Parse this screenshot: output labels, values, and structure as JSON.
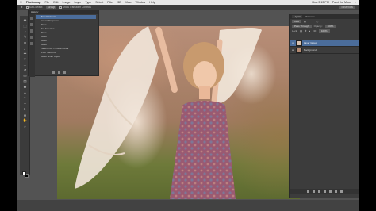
{
  "menubar": {
    "apple": "",
    "app_name": "Photoshop",
    "items": [
      "File",
      "Edit",
      "Image",
      "Layer",
      "Type",
      "Select",
      "Filter",
      "3D",
      "View",
      "Window",
      "Help"
    ],
    "right": [
      "Mon 3:13 PM",
      "Paint the Moon"
    ]
  },
  "options": {
    "auto_select_label": "Auto-Select:",
    "auto_select_value": "Group",
    "show_transform_label": "Show Transform Controls",
    "workspace": "Essentials"
  },
  "history_panel": {
    "title": "History",
    "items": [
      {
        "label": "Select Canvas",
        "selected": true
      },
      {
        "label": "Adjust Sharpness",
        "selected": false
      },
      {
        "label": "Move",
        "selected": false
      },
      {
        "label": "Set Selection",
        "selected": false
      },
      {
        "label": "Move",
        "selected": false
      },
      {
        "label": "Move",
        "selected": false
      },
      {
        "label": "Move",
        "selected": false
      },
      {
        "label": "Move",
        "selected": false
      },
      {
        "label": "Select Free Transform Area",
        "selected": false
      },
      {
        "label": "Free Transform",
        "selected": false
      },
      {
        "label": "Move Smart Object",
        "selected": false
      }
    ]
  },
  "layers_panel": {
    "tabs": [
      {
        "label": "Layers",
        "active": true
      },
      {
        "label": "Channels",
        "active": false
      }
    ],
    "kind_label": "Kind",
    "blend_mode": "Pass Through",
    "opacity_label": "Opacity:",
    "opacity_value": "100%",
    "lock_label": "Lock:",
    "fill_label": "Fill:",
    "fill_value": "100%",
    "layers": [
      {
        "name": "Layer Group",
        "selected": true,
        "thumb_color": "#d8c2b0"
      },
      {
        "name": "Background",
        "selected": false,
        "thumb_color": "#b38a72"
      }
    ]
  },
  "colors": {
    "selection": "#4b6d9b",
    "panel_bg": "#3c3c3c"
  }
}
